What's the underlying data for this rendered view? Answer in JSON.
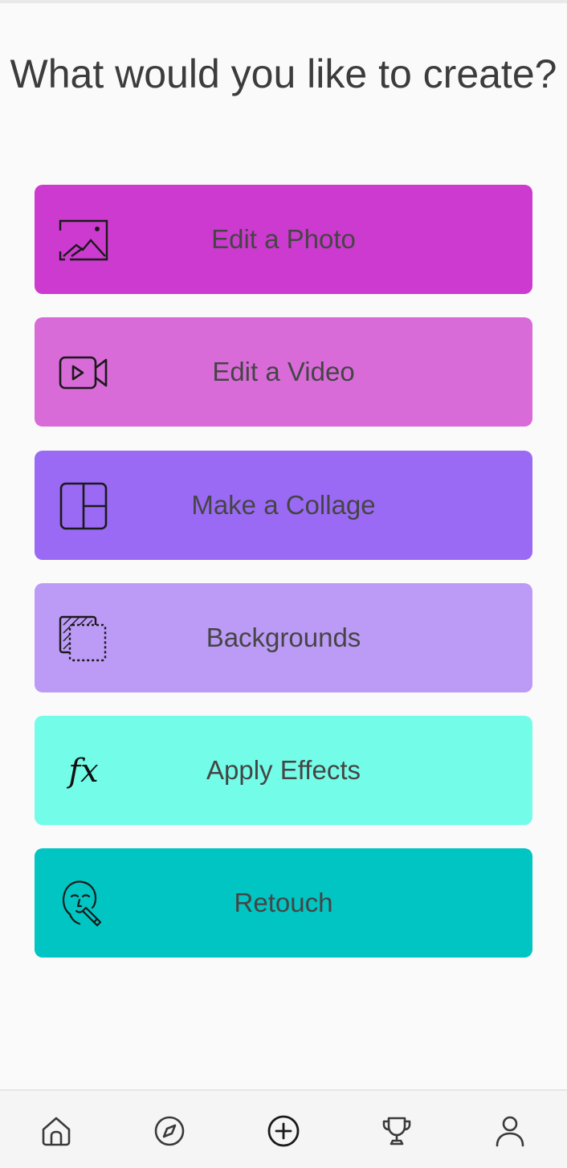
{
  "header": {
    "title": "What would you like to create?"
  },
  "options": [
    {
      "label": "Edit a Photo",
      "icon": "image-icon",
      "color": "#cd3acf"
    },
    {
      "label": "Edit a Video",
      "icon": "video-camera-icon",
      "color": "#d96bd9"
    },
    {
      "label": "Make a Collage",
      "icon": "collage-grid-icon",
      "color": "#9b6af4"
    },
    {
      "label": "Backgrounds",
      "icon": "backgrounds-layers-icon",
      "color": "#bc9bf6"
    },
    {
      "label": "Apply Effects",
      "icon": "fx-icon",
      "icon_text": "fx",
      "color": "#73fde8"
    },
    {
      "label": "Retouch",
      "icon": "face-retouch-icon",
      "color": "#00c5c2"
    }
  ],
  "bottom_nav": {
    "items": [
      {
        "icon": "home-icon"
      },
      {
        "icon": "compass-icon"
      },
      {
        "icon": "plus-circle-icon"
      },
      {
        "icon": "trophy-icon"
      },
      {
        "icon": "profile-icon"
      }
    ]
  }
}
